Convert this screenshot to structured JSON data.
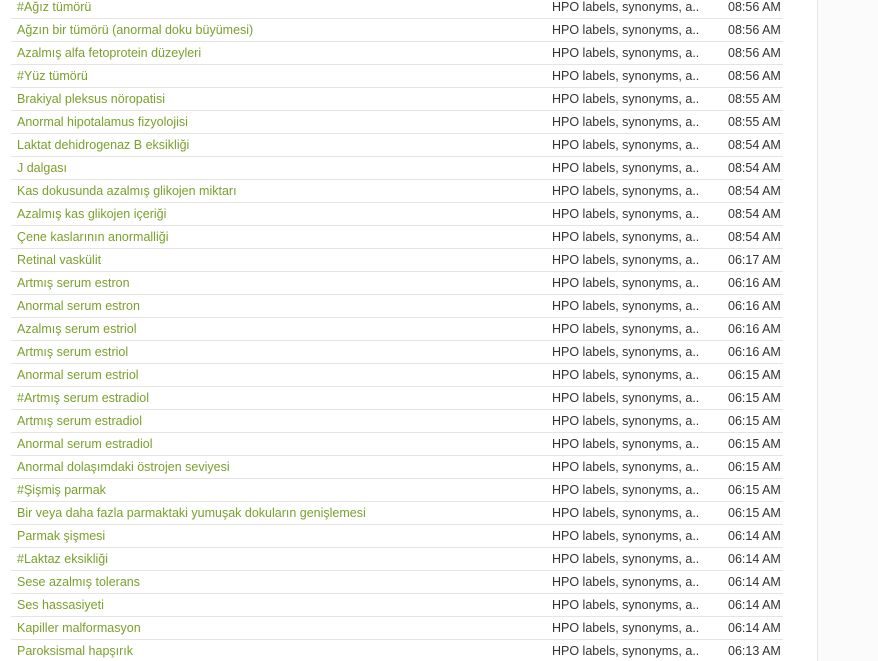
{
  "colors": {
    "link": "#7aa02c",
    "text": "#333333",
    "divider": "#e4e4e4"
  },
  "rows": [
    {
      "title": "#Ağız tümörü",
      "source": "HPO labels, synonyms, a...",
      "time": "08:56 AM"
    },
    {
      "title": "Ağzın bir tümörü (anormal doku büyümesi)",
      "source": "HPO labels, synonyms, a...",
      "time": "08:56 AM"
    },
    {
      "title": "Azalmış alfa fetoprotein düzeyleri",
      "source": "HPO labels, synonyms, a...",
      "time": "08:56 AM"
    },
    {
      "title": "#Yüz tümörü",
      "source": "HPO labels, synonyms, a...",
      "time": "08:56 AM"
    },
    {
      "title": "Brakiyal pleksus nöropatisi",
      "source": "HPO labels, synonyms, a...",
      "time": "08:55 AM"
    },
    {
      "title": "Anormal hipotalamus fizyolojisi",
      "source": "HPO labels, synonyms, a...",
      "time": "08:55 AM"
    },
    {
      "title": "Laktat dehidrogenaz B eksikliği",
      "source": "HPO labels, synonyms, a...",
      "time": "08:54 AM"
    },
    {
      "title": "J dalgası",
      "source": "HPO labels, synonyms, a...",
      "time": "08:54 AM"
    },
    {
      "title": "Kas dokusunda azalmış glikojen miktarı",
      "source": "HPO labels, synonyms, a...",
      "time": "08:54 AM"
    },
    {
      "title": "Azalmış kas glikojen içeriği",
      "source": "HPO labels, synonyms, a...",
      "time": "08:54 AM"
    },
    {
      "title": "Çene kaslarının anormalliği",
      "source": "HPO labels, synonyms, a...",
      "time": "08:54 AM"
    },
    {
      "title": "Retinal vaskülit",
      "source": "HPO labels, synonyms, a...",
      "time": "06:17 AM"
    },
    {
      "title": "Artmış serum estron",
      "source": "HPO labels, synonyms, a...",
      "time": "06:16 AM"
    },
    {
      "title": "Anormal serum estron",
      "source": "HPO labels, synonyms, a...",
      "time": "06:16 AM"
    },
    {
      "title": "Azalmış serum estriol",
      "source": "HPO labels, synonyms, a...",
      "time": "06:16 AM"
    },
    {
      "title": "Artmış serum estriol",
      "source": "HPO labels, synonyms, a...",
      "time": "06:16 AM"
    },
    {
      "title": "Anormal serum estriol",
      "source": "HPO labels, synonyms, a...",
      "time": "06:15 AM"
    },
    {
      "title": "#Artmış serum estradiol",
      "source": "HPO labels, synonyms, a...",
      "time": "06:15 AM"
    },
    {
      "title": "Artmış serum estradiol",
      "source": "HPO labels, synonyms, a...",
      "time": "06:15 AM"
    },
    {
      "title": "Anormal serum estradiol",
      "source": "HPO labels, synonyms, a...",
      "time": "06:15 AM"
    },
    {
      "title": "Anormal dolaşımdaki östrojen seviyesi",
      "source": "HPO labels, synonyms, a...",
      "time": "06:15 AM"
    },
    {
      "title": "#Şişmiş parmak",
      "source": "HPO labels, synonyms, a...",
      "time": "06:15 AM"
    },
    {
      "title": "Bir veya daha fazla parmaktaki yumuşak dokuların genişlemesi",
      "source": "HPO labels, synonyms, a...",
      "time": "06:15 AM"
    },
    {
      "title": "Parmak şişmesi",
      "source": "HPO labels, synonyms, a...",
      "time": "06:14 AM"
    },
    {
      "title": "#Laktaz eksikliği",
      "source": "HPO labels, synonyms, a...",
      "time": "06:14 AM"
    },
    {
      "title": "Sese azalmış tolerans",
      "source": "HPO labels, synonyms, a...",
      "time": "06:14 AM"
    },
    {
      "title": "Ses hassasiyeti",
      "source": "HPO labels, synonyms, a...",
      "time": "06:14 AM"
    },
    {
      "title": "Kapiller malformasyon",
      "source": "HPO labels, synonyms, a...",
      "time": "06:14 AM"
    },
    {
      "title": "Paroksismal hapşırık",
      "source": "HPO labels, synonyms, a...",
      "time": "06:13 AM"
    }
  ]
}
